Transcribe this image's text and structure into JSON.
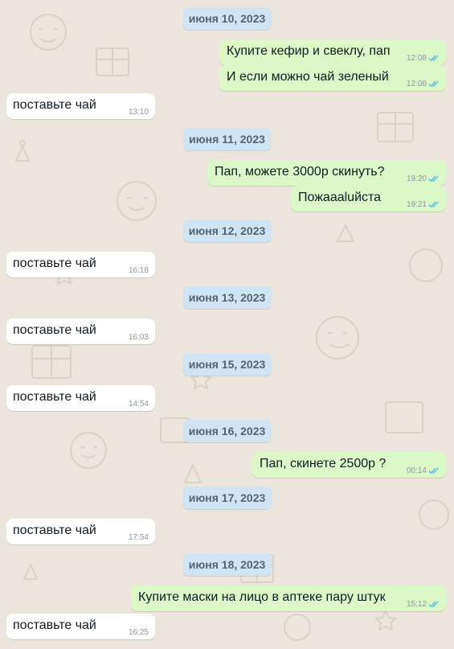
{
  "colors": {
    "wallpaper": "#ECE5DD",
    "incoming_bubble": "#FFFFFF",
    "outgoing_bubble": "#DCF8C6",
    "date_chip": "#D1E4F3",
    "read_ticks": "#53BDEB"
  },
  "chat": {
    "d1": "июня 10, 2023",
    "m1": {
      "text": "Купите кефир и свеклу, пап",
      "time": "12:08",
      "status": "read"
    },
    "m2": {
      "text": "И если можно чай зеленый",
      "time": "12:08",
      "status": "read"
    },
    "m3": {
      "text": "поставьте чай",
      "time": "13:10"
    },
    "d2": "июня 11, 2023",
    "m4": {
      "text": "Пап, можете 3000р скинуть?",
      "time": "19:20",
      "status": "read"
    },
    "m5": {
      "text": "Пожаааluйста",
      "time": "19:21",
      "status": "read"
    },
    "d3": "июня 12, 2023",
    "m6": {
      "text": "поставьте чай",
      "time": "16:18"
    },
    "d4": "июня 13, 2023",
    "m7": {
      "text": "поставьте чай",
      "time": "16:03"
    },
    "d5": "июня 15, 2023",
    "m8": {
      "text": "поставьте чай",
      "time": "14:54"
    },
    "d6": "июня 16, 2023",
    "m9": {
      "text": "Пап, скинете 2500р ?",
      "time": "00:14",
      "status": "read"
    },
    "d7": "июня 17, 2023",
    "m10": {
      "text": "поставьте чай",
      "time": "17:54"
    },
    "d8": "июня 18, 2023",
    "m11": {
      "text": "Купите маски на лицо в аптеке пару штук",
      "time": "15:12",
      "status": "read"
    },
    "m12": {
      "text": "поставьте чай",
      "time": "16:25"
    }
  }
}
